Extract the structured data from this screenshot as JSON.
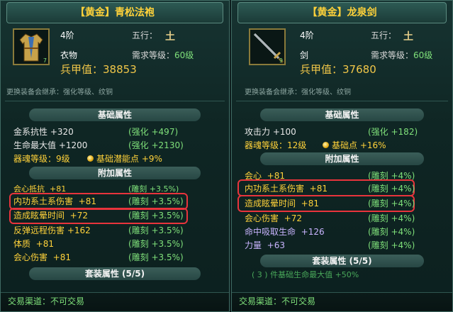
{
  "left_item": {
    "title": "【黄金】青松法袍",
    "grade": "4阶",
    "element_label": "五行：",
    "element_value": "土",
    "category": "衣物",
    "req_label": "需求等级：",
    "req_value": "60级",
    "gear_score_label": "兵甲值：",
    "gear_score_value": "38853",
    "icon_level": "7",
    "inherit_note": "更换装备会继承：强化等级、纹铜",
    "base_header": "基础属性",
    "base_attrs": [
      {
        "name": "金系抗性",
        "value": "+320",
        "bonus": "(强化 +497)"
      },
      {
        "name": "生命最大值",
        "value": "+1200",
        "bonus": "(强化 +2130)"
      }
    ],
    "soul_level_label": "器魂等级：9级",
    "soul_potential": "基础潜能点 +9%",
    "extra_header": "附加属性",
    "extra_attrs": [
      {
        "name": "会心抵抗",
        "value": "+81",
        "bonus": "(雕刻 +3.5%)",
        "color": "yellow"
      },
      {
        "name": "内功系土系伤害",
        "value": "+81",
        "bonus": "(雕刻 +3.5%)",
        "color": "yellow"
      },
      {
        "name": "造成眩晕时间",
        "value": "+72",
        "bonus": "(雕刻 +3.5%)",
        "color": "yellow"
      },
      {
        "name": "反弹远程伤害",
        "value": "+162",
        "bonus": "(雕刻 +3.5%)",
        "color": "yellow"
      },
      {
        "name": "体质",
        "value": "+81",
        "bonus": "(雕刻 +3.5%)",
        "color": "yellow"
      },
      {
        "name": "会心伤害",
        "value": "+81",
        "bonus": "(雕刻 +3.5%)",
        "color": "yellow"
      }
    ],
    "set_header": "套装属性 (5/5)",
    "trade": "交易渠道：不可交易"
  },
  "right_item": {
    "title": "【黄金】龙泉剑",
    "grade": "4阶",
    "element_label": "五行：",
    "element_value": "土",
    "category": "剑",
    "req_label": "需求等级：",
    "req_value": "60级",
    "gear_score_label": "兵甲值：",
    "gear_score_value": "37680",
    "icon_level": "9",
    "inherit_note": "更换装备会继承：强化等级、纹铜",
    "base_header": "基础属性",
    "base_attrs": [
      {
        "name": "攻击力",
        "value": "+100",
        "bonus": "(强化 +182)"
      }
    ],
    "soul_level_label": "器魂等级：12级",
    "soul_potential": "基础点 +16%",
    "extra_header": "附加属性",
    "extra_attrs": [
      {
        "name": "会心",
        "value": "+81",
        "bonus": "(雕刻 +4%)",
        "color": "yellow"
      },
      {
        "name": "内功系土系伤害",
        "value": "+81",
        "bonus": "(雕刻 +4%)",
        "color": "yellow"
      },
      {
        "name": "造成眩晕时间",
        "value": "+81",
        "bonus": "(雕刻 +4%)",
        "color": "yellow"
      },
      {
        "name": "会心伤害",
        "value": "+72",
        "bonus": "(雕刻 +4%)",
        "color": "yellow"
      },
      {
        "name": "命中吸取生命",
        "value": "+126",
        "bonus": "(雕刻 +4%)",
        "color": "purple"
      },
      {
        "name": "力量",
        "value": "+63",
        "bonus": "(雕刻 +4%)",
        "color": "purple"
      }
    ],
    "set_header": "套装属性 (5/5)",
    "set_line": "( 3 ) 件基础生命最大值 +50%",
    "trade": "交易渠道：不可交易"
  },
  "colors": {
    "title_gold": "#ffd23a",
    "attr_green": "#7fe07a",
    "highlight_red": "#e8343c"
  }
}
